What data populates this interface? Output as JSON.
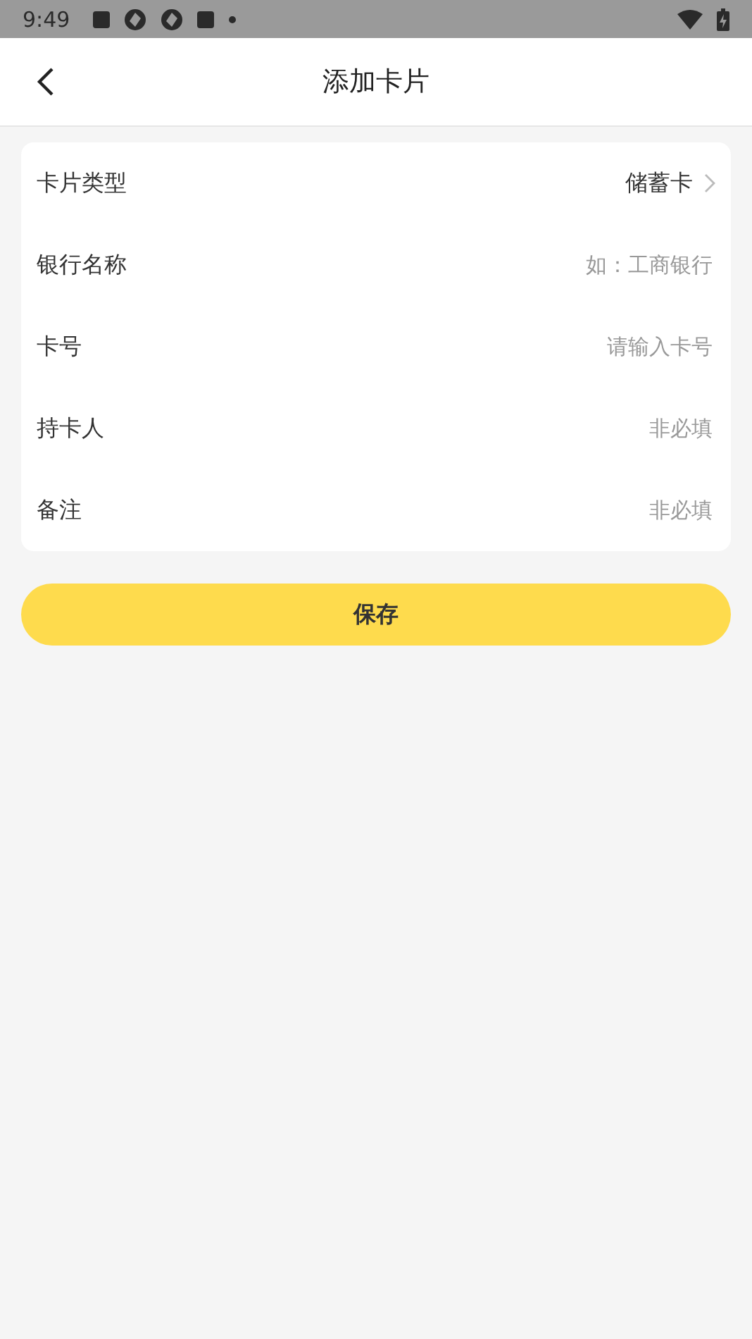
{
  "status_bar": {
    "time": "9:49",
    "notification_icons": [
      {
        "kind": "square"
      },
      {
        "kind": "aperture"
      },
      {
        "kind": "aperture"
      },
      {
        "kind": "square"
      },
      {
        "kind": "dot"
      }
    ]
  },
  "header": {
    "title": "添加卡片"
  },
  "form": {
    "rows": [
      {
        "kind": "select",
        "label": "卡片类型",
        "value": "储蓄卡"
      },
      {
        "kind": "input",
        "label": "银行名称",
        "placeholder": "如：工商银行"
      },
      {
        "kind": "input",
        "label": "卡号",
        "placeholder": "请输入卡号"
      },
      {
        "kind": "input",
        "label": "持卡人",
        "placeholder": "非必填"
      },
      {
        "kind": "input",
        "label": "备注",
        "placeholder": "非必填"
      }
    ]
  },
  "save_button": {
    "label": "保存"
  }
}
